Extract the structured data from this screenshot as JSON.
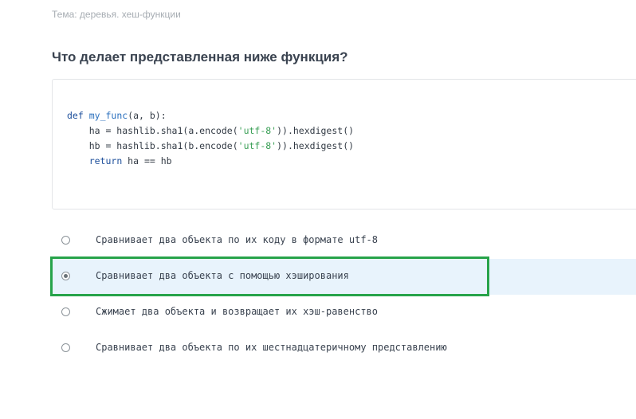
{
  "topic": "Тема: деревья. хеш-функции",
  "question": "Что делает представленная ниже функция?",
  "code": {
    "line1": {
      "kw": "def",
      "fn": "my_func",
      "rest": "(a, b):"
    },
    "line2": {
      "pre": "    ha = hashlib.sha1(a.encode(",
      "str": "'utf-8'",
      "post": ")).hexdigest()"
    },
    "line3": {
      "pre": "    hb = hashlib.sha1(b.encode(",
      "str": "'utf-8'",
      "post": ")).hexdigest()"
    },
    "line4": {
      "indent": "    ",
      "kw": "return",
      "rest": " ha == hb"
    }
  },
  "options": [
    {
      "label": "Сравнивает два объекта по их коду в формате utf-8",
      "selected": false
    },
    {
      "label": "Сравнивает два объекта с помощью хэширования",
      "selected": true
    },
    {
      "label": "Сжимает два объекта и возвращает их хэш-равенство",
      "selected": false
    },
    {
      "label": "Сравнивает два объекта по их шестнадцатеричному представлению",
      "selected": false
    }
  ],
  "colors": {
    "selected_background": "#e8f3fc",
    "highlight_frame": "#27a34a",
    "keyword": "#1d4f9b",
    "string": "#3a9f56"
  }
}
